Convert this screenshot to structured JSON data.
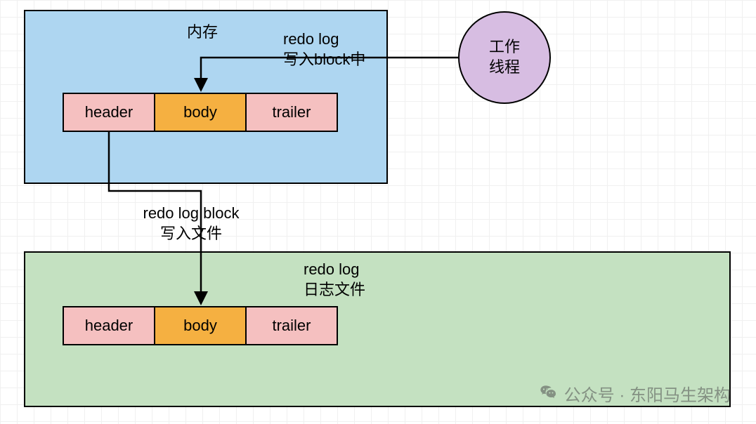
{
  "memory": {
    "title": "内存",
    "blocks": [
      "header",
      "body",
      "trailer"
    ]
  },
  "file": {
    "blocks": [
      "header",
      "body",
      "trailer"
    ]
  },
  "worker": {
    "label": "工作\n线程"
  },
  "arrows": {
    "to_block": "redo log\n写入block中",
    "to_file": "redo log block\n写入文件",
    "file_label": "redo log\n日志文件"
  },
  "watermark": {
    "text": "公众号 · 东阳马生架构"
  }
}
